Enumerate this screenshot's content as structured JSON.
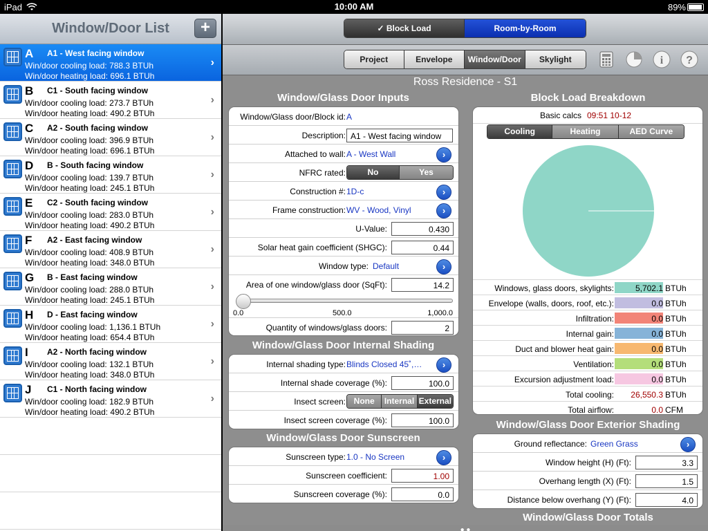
{
  "status": {
    "carrier": "iPad",
    "time": "10:00 AM",
    "battery": "89%"
  },
  "left": {
    "title": "Window/Door List",
    "add_label": "+",
    "items": [
      {
        "id": "A",
        "name": "A1 - West facing window",
        "cooling": "Win/door cooling load: 788.3 BTUh",
        "heating": "Win/door heating load: 696.1 BTUh"
      },
      {
        "id": "B",
        "name": "C1 - South facing window",
        "cooling": "Win/door cooling load: 273.7 BTUh",
        "heating": "Win/door heating load: 490.2 BTUh"
      },
      {
        "id": "C",
        "name": "A2 - South facing window",
        "cooling": "Win/door cooling load: 396.9 BTUh",
        "heating": "Win/door heating load: 696.1 BTUh"
      },
      {
        "id": "D",
        "name": "B - South facing window",
        "cooling": "Win/door cooling load: 139.7 BTUh",
        "heating": "Win/door heating load: 245.1 BTUh"
      },
      {
        "id": "E",
        "name": "C2 - South facing window",
        "cooling": "Win/door cooling load: 283.0 BTUh",
        "heating": "Win/door heating load: 490.2 BTUh"
      },
      {
        "id": "F",
        "name": "A2 - East facing window",
        "cooling": "Win/door cooling load: 408.9 BTUh",
        "heating": "Win/door heating load: 348.0 BTUh"
      },
      {
        "id": "G",
        "name": "B - East facing window",
        "cooling": "Win/door cooling load: 288.0 BTUh",
        "heating": "Win/door heating load: 245.1 BTUh"
      },
      {
        "id": "H",
        "name": "D - East facing window",
        "cooling": "Win/door cooling load: 1,136.1 BTUh",
        "heating": "Win/door heating load: 654.4 BTUh"
      },
      {
        "id": "I",
        "name": "A2 - North facing window",
        "cooling": "Win/door cooling load: 132.1 BTUh",
        "heating": "Win/door heating load: 348.0 BTUh"
      },
      {
        "id": "J",
        "name": "C1 - North facing window",
        "cooling": "Win/door cooling load: 182.9 BTUh",
        "heating": "Win/door heating load: 490.2 BTUh"
      }
    ]
  },
  "top": {
    "mode_block": "Block Load",
    "mode_room": "Room-by-Room",
    "tab_project": "Project",
    "tab_envelope": "Envelope",
    "tab_window": "Window/Door",
    "tab_skylight": "Skylight"
  },
  "project_title": "Ross Residence - S1",
  "inputs": {
    "section": "Window/Glass Door Inputs",
    "block_id_label": "Window/Glass door/Block id:",
    "block_id_value": "A",
    "desc_label": "Description:",
    "desc_value": "A1 - West facing window",
    "wall_label": "Attached to wall:",
    "wall_value": "A - West Wall",
    "nfrc_label": "NFRC rated:",
    "nfrc_no": "No",
    "nfrc_yes": "Yes",
    "construction_label": "Construction #:",
    "construction_value": "1D-c",
    "frame_label": "Frame construction:",
    "frame_value": "WV - Wood, Vinyl",
    "uvalue_label": "U-Value:",
    "uvalue_value": "0.430",
    "shgc_label": "Solar heat gain coefficient (SHGC):",
    "shgc_value": "0.44",
    "wtype_label": "Window type:",
    "wtype_value": "Default",
    "area_label": "Area of one window/glass door (SqFt):",
    "area_value": "14.2",
    "slider_min": "0.0",
    "slider_mid": "500.0",
    "slider_max": "1,000.0",
    "slider_fraction": 0.0142,
    "qty_label": "Quantity of windows/glass doors:",
    "qty_value": "2"
  },
  "shading": {
    "section": "Window/Glass Door Internal Shading",
    "type_label": "Internal shading type:",
    "type_value": "Blinds Closed 45˚,…",
    "coverage_label": "Internal shade coverage (%):",
    "coverage_value": "100.0",
    "insect_label": "Insect screen:",
    "insect_none": "None",
    "insect_internal": "Internal",
    "insect_external": "External",
    "insect_cov_label": "Insect screen coverage (%):",
    "insect_cov_value": "100.0"
  },
  "sunscreen": {
    "section": "Window/Glass Door Sunscreen",
    "type_label": "Sunscreen type:",
    "type_value": "1.0 - No Screen",
    "coef_label": "Sunscreen coefficient:",
    "coef_value": "1.00",
    "cov_label": "Sunscreen coverage (%):",
    "cov_value": "0.0"
  },
  "breakdown": {
    "section": "Block Load Breakdown",
    "basic_label": "Basic calcs",
    "basic_value": "09:51 10-12",
    "tab_cooling": "Cooling",
    "tab_heating": "Heating",
    "tab_aed": "AED Curve",
    "rows": [
      {
        "label": "Windows, glass doors, skylights:",
        "value": "5,702.1",
        "unit": "BTUh",
        "color": "#8fd6c7"
      },
      {
        "label": "Envelope (walls, doors, roof, etc.):",
        "value": "0.0",
        "unit": "BTUh",
        "color": "#c1bde0"
      },
      {
        "label": "Infiltration:",
        "value": "0.0",
        "unit": "BTUh",
        "color": "#f28478"
      },
      {
        "label": "Internal gain:",
        "value": "0.0",
        "unit": "BTUh",
        "color": "#86b3d8"
      },
      {
        "label": "Duct and blower heat gain:",
        "value": "0.0",
        "unit": "BTUh",
        "color": "#f7b870"
      },
      {
        "label": "Ventilation:",
        "value": "0.0",
        "unit": "BTUh",
        "color": "#b4de7a"
      },
      {
        "label": "Excursion adjustment load:",
        "value": "0.0",
        "unit": "BTUh",
        "color": "#f6c7e1"
      }
    ],
    "total_cool_label": "Total cooling:",
    "total_cool_value": "26,550.3",
    "total_cool_unit": "BTUh",
    "airflow_label": "Total airflow:",
    "airflow_value": "0.0",
    "airflow_unit": "CFM"
  },
  "exterior": {
    "section": "Window/Glass Door Exterior Shading",
    "ground_label": "Ground reflectance:",
    "ground_value": "Green Grass",
    "height_label": "Window height (H) (Ft):",
    "height_value": "3.3",
    "overhang_label": "Overhang length (X) (Ft):",
    "overhang_value": "1.5",
    "dist_label": "Distance below overhang (Y) (Ft):",
    "dist_value": "4.0"
  },
  "totals": {
    "section": "Window/Glass Door Totals"
  },
  "pager": {
    "dots": "● ●"
  }
}
